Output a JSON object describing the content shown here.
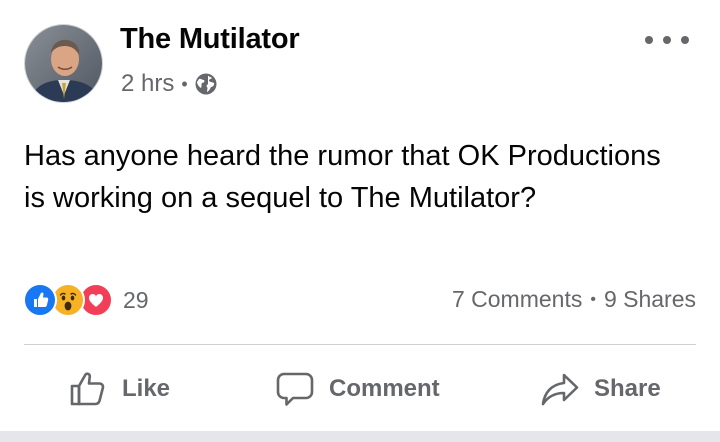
{
  "post": {
    "author": "The Mutilator",
    "time": "2 hrs",
    "privacy_icon": "globe-icon",
    "text": "Has anyone heard the rumor that OK Productions is working on a sequel to The Mutilator?"
  },
  "stats": {
    "reaction_icons": [
      "like-reaction-icon",
      "wow-reaction-icon",
      "love-reaction-icon"
    ],
    "reaction_count": "29",
    "comments": "7 Comments",
    "shares": "9 Shares"
  },
  "actions": {
    "like_label": "Like",
    "comment_label": "Comment",
    "share_label": "Share"
  },
  "colors": {
    "text": "#050505",
    "secondary_text": "#65676b",
    "like_blue": "#1877f2",
    "wow_yellow": "#f7b125",
    "love_red": "#f33e58",
    "divider": "#ced0d4"
  }
}
